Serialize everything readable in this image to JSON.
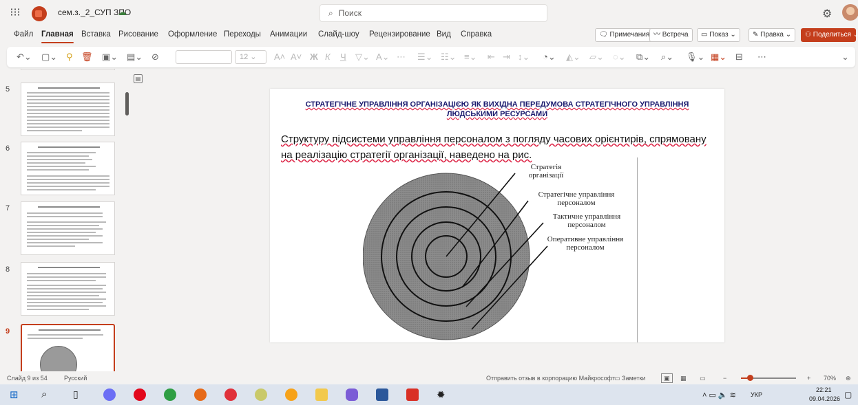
{
  "titlebar": {
    "doc_name": "сем.з._2_СУП ЗПО",
    "search_placeholder": "Поиск"
  },
  "menu": {
    "tabs": [
      "Файл",
      "Главная",
      "Вставка",
      "Рисование",
      "Оформление",
      "Переходы",
      "Анимации",
      "Слайд-шоу",
      "Рецензирование",
      "Вид",
      "Справка"
    ],
    "active": "Главная"
  },
  "ribbon_right": {
    "comments": "Примечания",
    "meeting": "Встреча",
    "show": "Показ",
    "edit": "Правка",
    "share": "Поделиться"
  },
  "toolbar": {
    "font_size": "12"
  },
  "thumbnails": {
    "numbers": [
      "5",
      "6",
      "7",
      "8",
      "9"
    ],
    "selected": "9"
  },
  "slide": {
    "title": "СТРАТЕГІЧНЕ УПРАВЛІННЯ ОРГАНІЗАЦІЄЮ ЯК ВИХІДНА ПЕРЕДУМОВА СТРАТЕГІЧНОГО УПРАВЛІННЯ ЛЮДСЬКИМИ РЕСУРСАМИ",
    "body": "Структуру підсистеми управління персоналом з погляду часових  орієнтирів, спрямовану  на  реалізацію  стратегії  організації, наведено на рис.",
    "labels": {
      "l1": "Стратегія організації",
      "l2": "Стратегічне управління персоналом",
      "l3": "Тактичне управління персоналом",
      "l4": "Оперативне управління персоналом"
    }
  },
  "statusbar": {
    "slide_info": "Слайд 9 из 54",
    "language": "Русский",
    "feedback": "Отправить отзыв в корпорацию Майкрософт",
    "notes": "Заметки",
    "zoom": "70%"
  },
  "taskbar": {
    "lang": "УКР",
    "time": "22:21",
    "date": "09.04.2026"
  },
  "colors": {
    "accent": "#c43e1c",
    "title_blue": "#1a1a6e"
  }
}
